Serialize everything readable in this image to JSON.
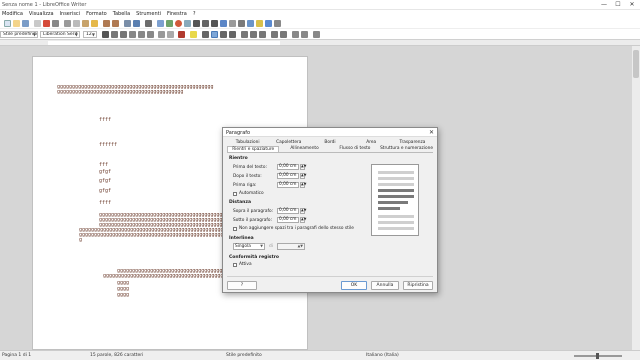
{
  "window": {
    "title": "Senza nome 1 - LibreOffice Writer",
    "minimize": "—",
    "maximize": "☐",
    "close": "✕"
  },
  "menubar": [
    "Modifica",
    "Visualizza",
    "Inserisci",
    "Formato",
    "Tabella",
    "Strumenti",
    "Finestra",
    "?"
  ],
  "formatting": {
    "paragraph_style": "Stile predefinito",
    "font_name": "Liberation Serif",
    "font_size": "12"
  },
  "document": {
    "lines": [
      "gggggggggggggggggggggggggggggggggggggggggggggggggggg",
      "gggggggggggggggggggggggggggggggggggggggggg",
      "ffff",
      "ffffff",
      "fff",
      "gfgf",
      "gfgf",
      "gfgf",
      "ffff",
      "ggggggggggggggggggggggggggggggggggggggggg",
      "ggggggggggggggggggggggggggggggggggggggggg",
      "ggggggggggggggggggggggggggggggggggggggggg",
      "ggggggggggggggggggggggggggggggggggggggggggggggggggggggggg",
      "gggggggggggggggggggggggggggggggggggggggggggggggggggggggg",
      "g",
      "ggggggggggggggggggggggggggggggggggggggggg",
      "gggggggggggggggggggggggggggggggggggggggggggggg",
      "gggg",
      "gggg",
      "gggg"
    ]
  },
  "statusbar": {
    "page": "Pagina 1 di 1",
    "words": "15 parole, 826 caratteri",
    "style": "Stile predefinito",
    "language": "Italiano (Italia)"
  },
  "dialog": {
    "title": "Paragrafo",
    "close": "✕",
    "tabs_row1": [
      "Tabulazioni",
      "Capolettera",
      "Bordi",
      "Area",
      "Trasparenza"
    ],
    "tabs_row2": [
      "Rientri e spaziature",
      "Allineamento",
      "Flusso di testo",
      "Struttura e numerazione"
    ],
    "active_tab": "Rientri e spaziature",
    "indent": {
      "heading": "Rientro",
      "before_label": "Prima del testo:",
      "before_value": "0,00 cm",
      "after_label": "Dopo il testo:",
      "after_value": "0,00 cm",
      "first_line_label": "Prima riga:",
      "first_line_value": "0,00 cm",
      "automatic_label": "Automatico"
    },
    "spacing": {
      "heading": "Distanza",
      "above_label": "Sopra il paragrafo:",
      "above_value": "0,00 cm",
      "below_label": "Sotto il paragrafo:",
      "below_value": "0,00 cm",
      "no_space_label": "Non aggiungere spazi tra i paragrafi dello stesso stile"
    },
    "line_spacing": {
      "heading": "Interlinea",
      "value": "Singola",
      "of_label": "di"
    },
    "register": {
      "heading": "Conformità registro",
      "activate_label": "Attiva"
    },
    "buttons": {
      "help": "?",
      "ok": "OK",
      "cancel": "Annulla",
      "reset": "Ripristina"
    }
  }
}
